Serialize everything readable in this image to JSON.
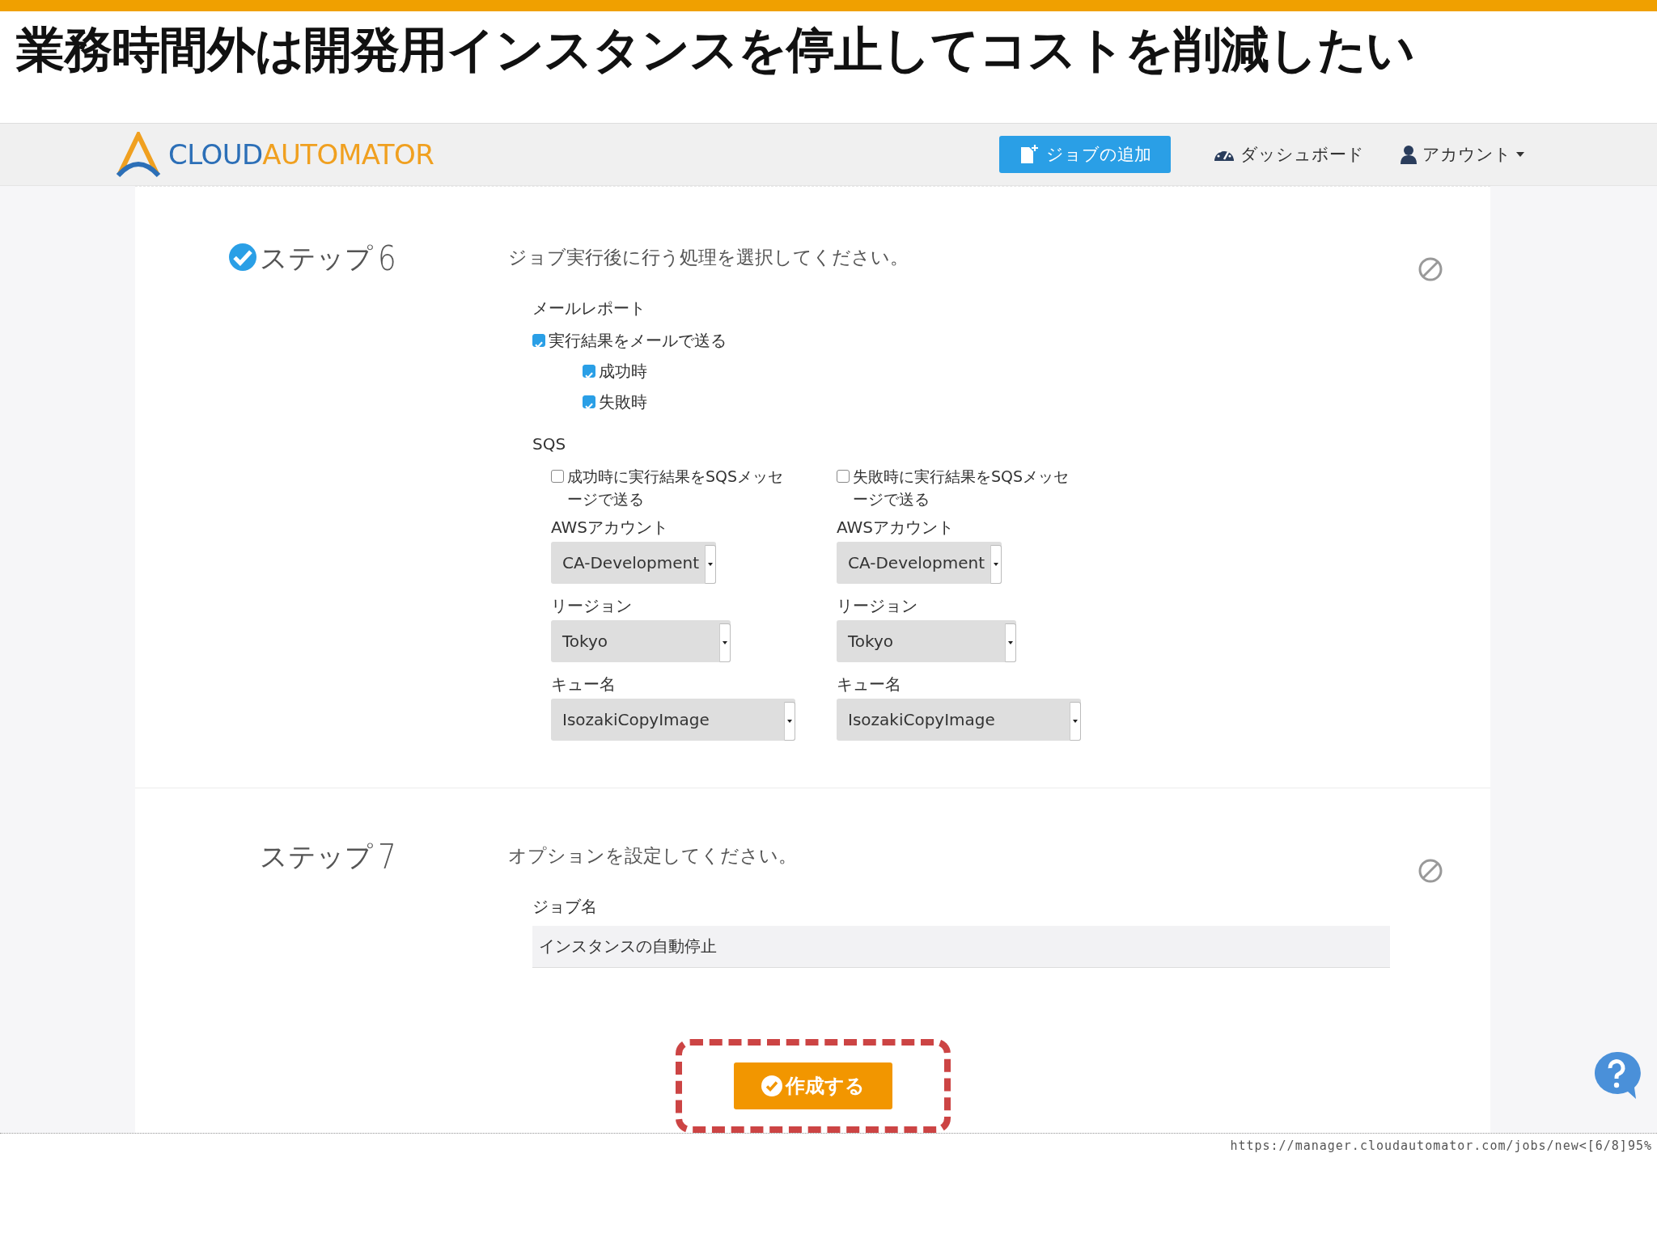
{
  "slide_title": "業務時間外は開発用インスタンスを停止してコストを削減したい",
  "navbar": {
    "logo_parts": [
      "CLOUD",
      "AUTOMATOR"
    ],
    "add_job_button": "ジョブの追加",
    "links": [
      {
        "kind": "dashboard",
        "label": "ダッシュボード"
      },
      {
        "kind": "account",
        "label": "アカウント"
      }
    ]
  },
  "steps": [
    {
      "label": "ステップ",
      "number": "6",
      "done": true,
      "description": "ジョブ実行後に行う処理を選択してください。",
      "email": {
        "heading": "メールレポート",
        "main": {
          "label": "実行結果をメールで送る",
          "checked": true
        },
        "options": [
          {
            "label": "成功時",
            "checked": true
          },
          {
            "label": "失敗時",
            "checked": true
          }
        ]
      },
      "sqs": {
        "heading": "SQS",
        "columns": [
          {
            "checkbox": {
              "label": "成功時に実行結果をSQSメッセージで送る",
              "checked": false
            },
            "selects": [
              {
                "label": "AWSアカウント",
                "value": "CA-Development"
              },
              {
                "label": "リージョン",
                "value": "Tokyo"
              },
              {
                "label": "キュー名",
                "value": "IsozakiCopyImage"
              }
            ]
          },
          {
            "checkbox": {
              "label": "失敗時に実行結果をSQSメッセージで送る",
              "checked": false
            },
            "selects": [
              {
                "label": "AWSアカウント",
                "value": "CA-Development"
              },
              {
                "label": "リージョン",
                "value": "Tokyo"
              },
              {
                "label": "キュー名",
                "value": "IsozakiCopyImage"
              }
            ]
          }
        ]
      }
    },
    {
      "label": "ステップ",
      "number": "7",
      "done": false,
      "description": "オプションを設定してください。",
      "job_name": {
        "label": "ジョブ名",
        "value": "インスタンスの自動停止"
      }
    }
  ],
  "create_button": "作成する",
  "status_url": "https://manager.cloudautomator.com/jobs/new<[6/8]95%"
}
